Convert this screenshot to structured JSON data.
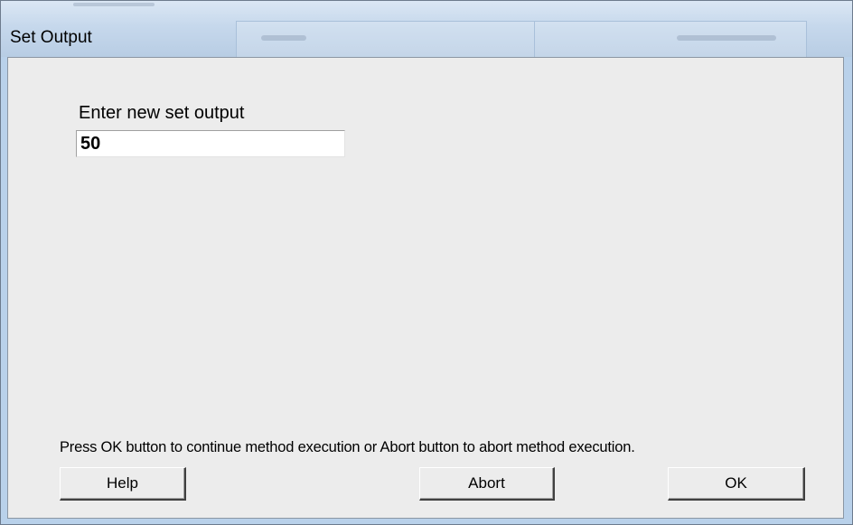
{
  "window": {
    "title": "Set Output"
  },
  "form": {
    "field_label": "Enter new set output",
    "field_value": "50"
  },
  "instruction": "Press OK button to continue method execution or Abort button to abort method execution.",
  "buttons": {
    "help": "Help",
    "abort": "Abort",
    "ok": "OK"
  },
  "colors": {
    "dialog_background": "#ececec",
    "title_bar": "#c6d8ec"
  }
}
